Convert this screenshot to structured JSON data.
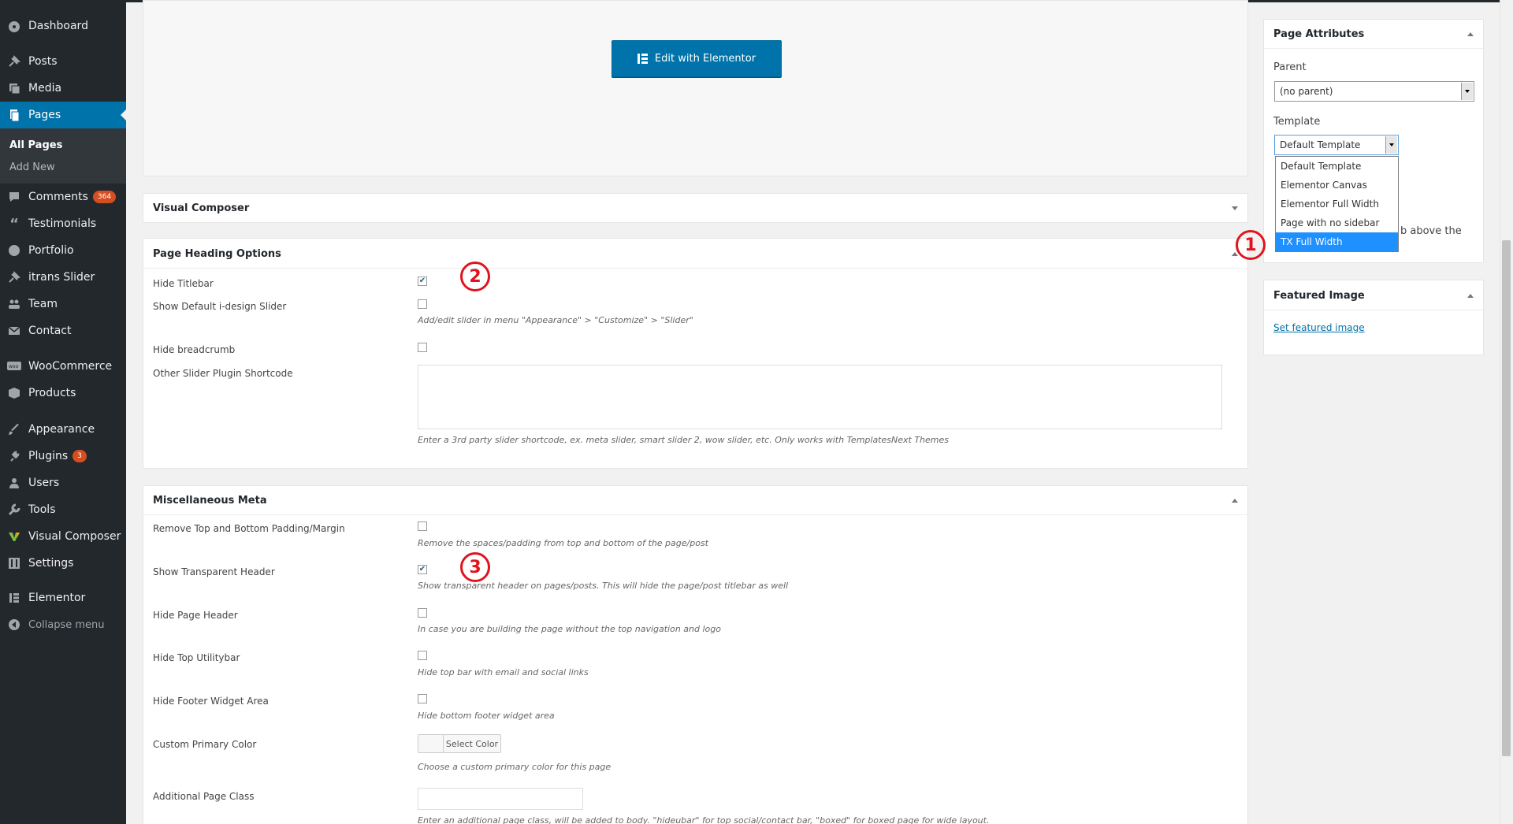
{
  "sidebar": {
    "items": [
      {
        "label": "Dashboard",
        "icon": "dashboard-icon"
      },
      {
        "label": "Posts",
        "icon": "pin-icon"
      },
      {
        "label": "Media",
        "icon": "media-icon"
      },
      {
        "label": "Pages",
        "icon": "pages-icon"
      },
      {
        "label": "Comments",
        "icon": "comment-icon",
        "badge": "364"
      },
      {
        "label": "Testimonials",
        "icon": "quote-icon"
      },
      {
        "label": "Portfolio",
        "icon": "portfolio-icon"
      },
      {
        "label": "itrans Slider",
        "icon": "pin-icon"
      },
      {
        "label": "Team",
        "icon": "team-icon"
      },
      {
        "label": "Contact",
        "icon": "mail-icon"
      },
      {
        "label": "WooCommerce",
        "icon": "woocommerce-icon"
      },
      {
        "label": "Products",
        "icon": "products-icon"
      },
      {
        "label": "Appearance",
        "icon": "brush-icon"
      },
      {
        "label": "Plugins",
        "icon": "plugin-icon",
        "badge": "3"
      },
      {
        "label": "Users",
        "icon": "user-icon"
      },
      {
        "label": "Tools",
        "icon": "wrench-icon"
      },
      {
        "label": "Visual Composer",
        "icon": "visual-composer-icon"
      },
      {
        "label": "Settings",
        "icon": "settings-icon"
      },
      {
        "label": "Elementor",
        "icon": "elementor-icon"
      },
      {
        "label": "Collapse menu",
        "icon": "collapse-icon"
      }
    ],
    "submenu": [
      {
        "label": "All Pages"
      },
      {
        "label": "Add New"
      }
    ]
  },
  "main": {
    "elementor_button": "Edit with Elementor",
    "visual_composer_title": "Visual Composer",
    "page_heading": {
      "title": "Page Heading Options",
      "hide_titlebar": {
        "label": "Hide Titlebar",
        "checked": true
      },
      "show_default_slider": {
        "label": "Show Default i-design Slider",
        "checked": false,
        "desc": "Add/edit slider in menu \"Appearance\" > \"Customize\" > \"Slider\""
      },
      "hide_breadcrumb": {
        "label": "Hide breadcrumb",
        "checked": false
      },
      "other_slider": {
        "label": "Other Slider Plugin Shortcode",
        "value": "",
        "desc": "Enter a 3rd party slider shortcode, ex. meta slider, smart slider 2, wow slider, etc. Only works with TemplatesNext Themes"
      }
    },
    "misc": {
      "title": "Miscellaneous Meta",
      "remove_padding": {
        "label": "Remove Top and Bottom Padding/Margin",
        "checked": false,
        "desc": "Remove the spaces/padding from top and bottom of the page/post"
      },
      "transparent_header": {
        "label": "Show Transparent Header",
        "checked": true,
        "desc": "Show transparent header on pages/posts. This will hide the page/post titlebar as well"
      },
      "hide_page_header": {
        "label": "Hide Page Header",
        "checked": false,
        "desc": "In case you are building the page without the top navigation and logo"
      },
      "hide_top_utilitybar": {
        "label": "Hide Top Utilitybar",
        "checked": false,
        "desc": "Hide top bar with email and social links"
      },
      "hide_footer_widget": {
        "label": "Hide Footer Widget Area",
        "checked": false,
        "desc": "Hide bottom footer widget area"
      },
      "custom_color": {
        "label": "Custom Primary Color",
        "button": "Select Color",
        "desc": "Choose a custom primary color for this page"
      },
      "additional_class": {
        "label": "Additional Page Class",
        "value": "",
        "desc": "Enter an additional page class, will be added to body. \"hideubar\" for top social/contact bar, \"boxed\" for boxed page for wide layout."
      }
    }
  },
  "right": {
    "page_attributes": {
      "title": "Page Attributes",
      "parent_label": "Parent",
      "parent_value": "(no parent)",
      "template_label": "Template",
      "template_value": "Default Template",
      "template_options": [
        "Default Template",
        "Elementor Canvas",
        "Elementor Full Width",
        "Page with no sidebar",
        "TX Full Width"
      ],
      "hidden_text": "b above the"
    },
    "featured_image": {
      "title": "Featured Image",
      "link": "Set featured image"
    }
  },
  "markers": [
    "1",
    "2",
    "3"
  ],
  "colors": {
    "sidebar": "#23282d",
    "accent": "#0073aa",
    "marker": "#e0141e",
    "highlight": "#1e90ff"
  }
}
